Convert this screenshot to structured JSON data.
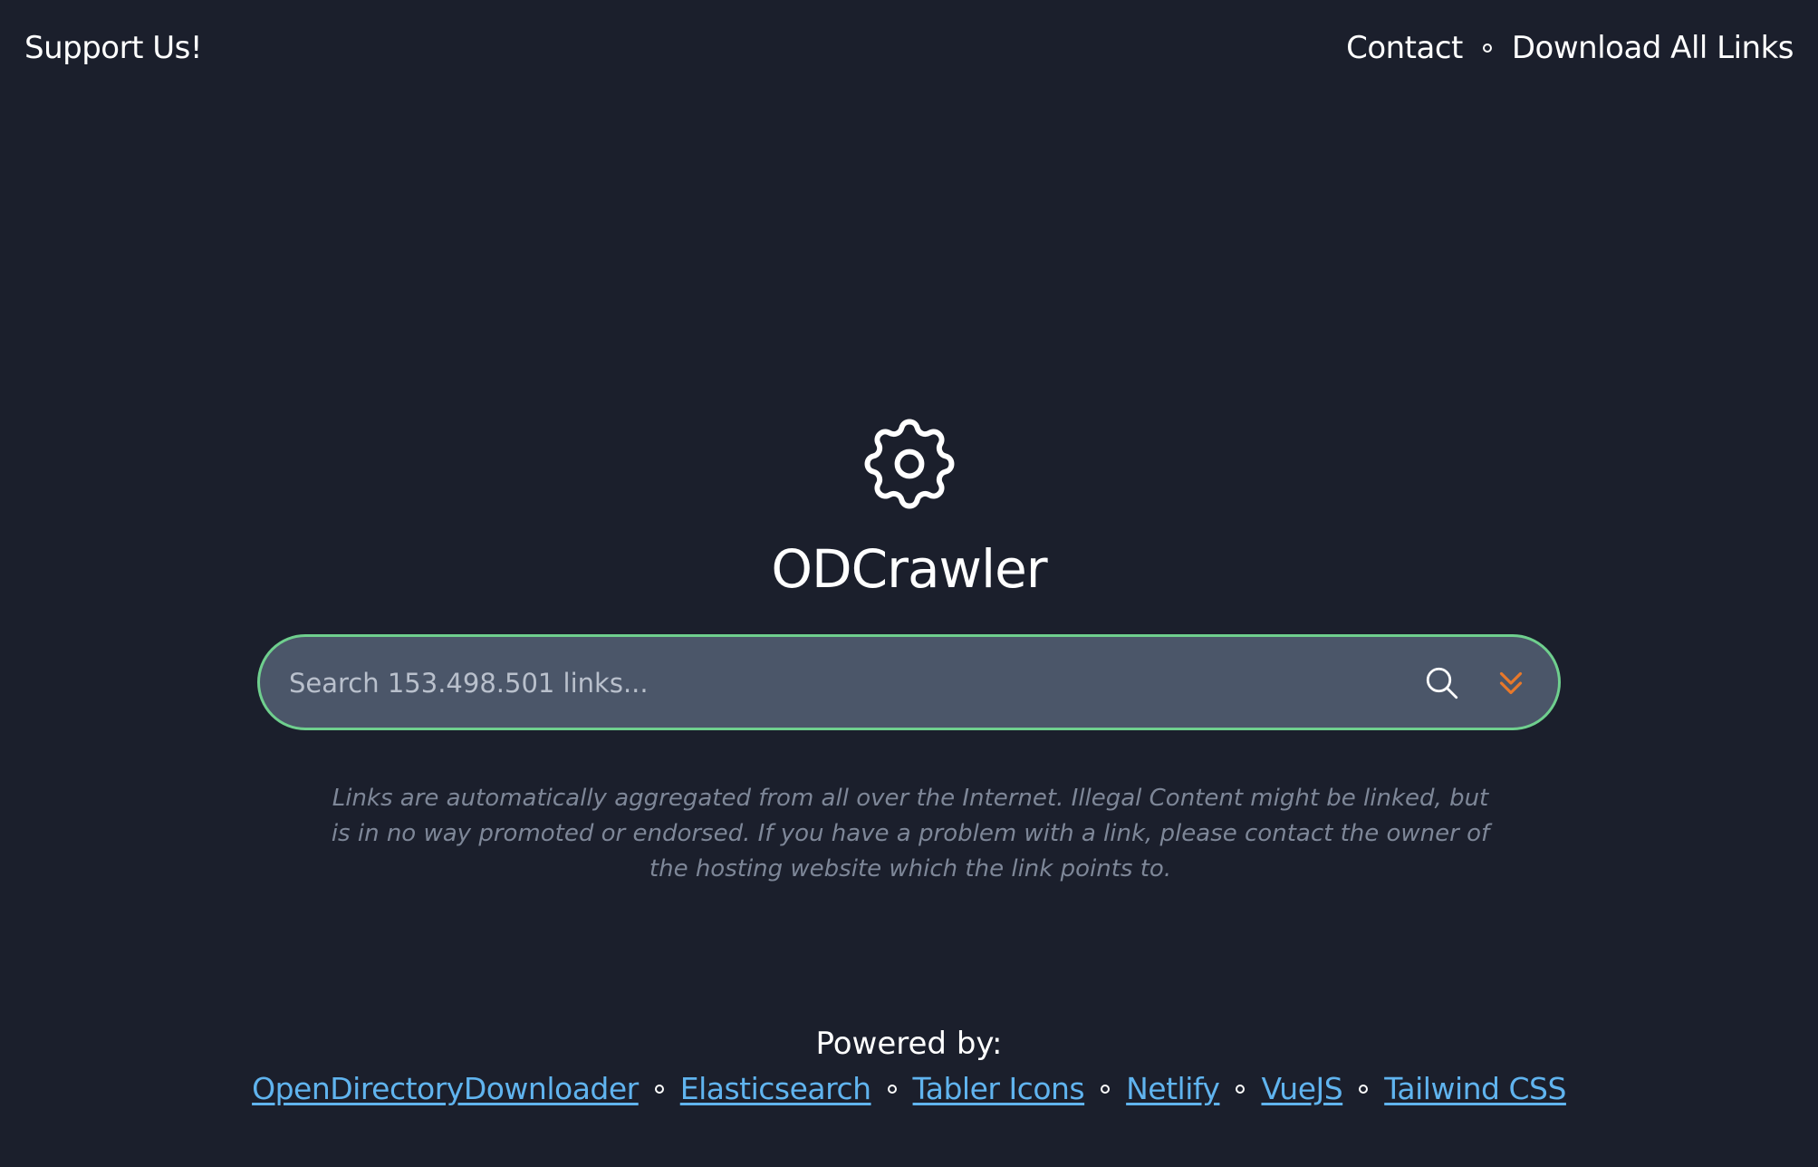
{
  "nav": {
    "support_label": "Support Us!",
    "contact_label": "Contact",
    "download_label": "Download All Links"
  },
  "brand": {
    "logo_icon": "settings-gear-icon",
    "title": "ODCrawler"
  },
  "search": {
    "placeholder": "Search 153.498.501 links...",
    "value": "",
    "search_icon": "search-icon",
    "expand_icon": "chevrons-down-icon"
  },
  "disclaimer": "Links are automatically aggregated from all over the Internet. Illegal Content might be linked, but is in no way promoted or endorsed. If you have a problem with a link, please contact the owner of the hosting website which the link points to.",
  "footer": {
    "powered_by_label": "Powered by:",
    "credits": [
      "OpenDirectoryDownloader",
      "Elasticsearch",
      "Tabler Icons",
      "Netlify",
      "VueJS",
      "Tailwind CSS"
    ]
  },
  "colors": {
    "background": "#1b1f2c",
    "search_bg": "#4b5669",
    "search_border": "#6fcf8e",
    "link": "#60b4ef",
    "accent_orange": "#e8782a",
    "disclaimer_text": "#7e8798"
  }
}
